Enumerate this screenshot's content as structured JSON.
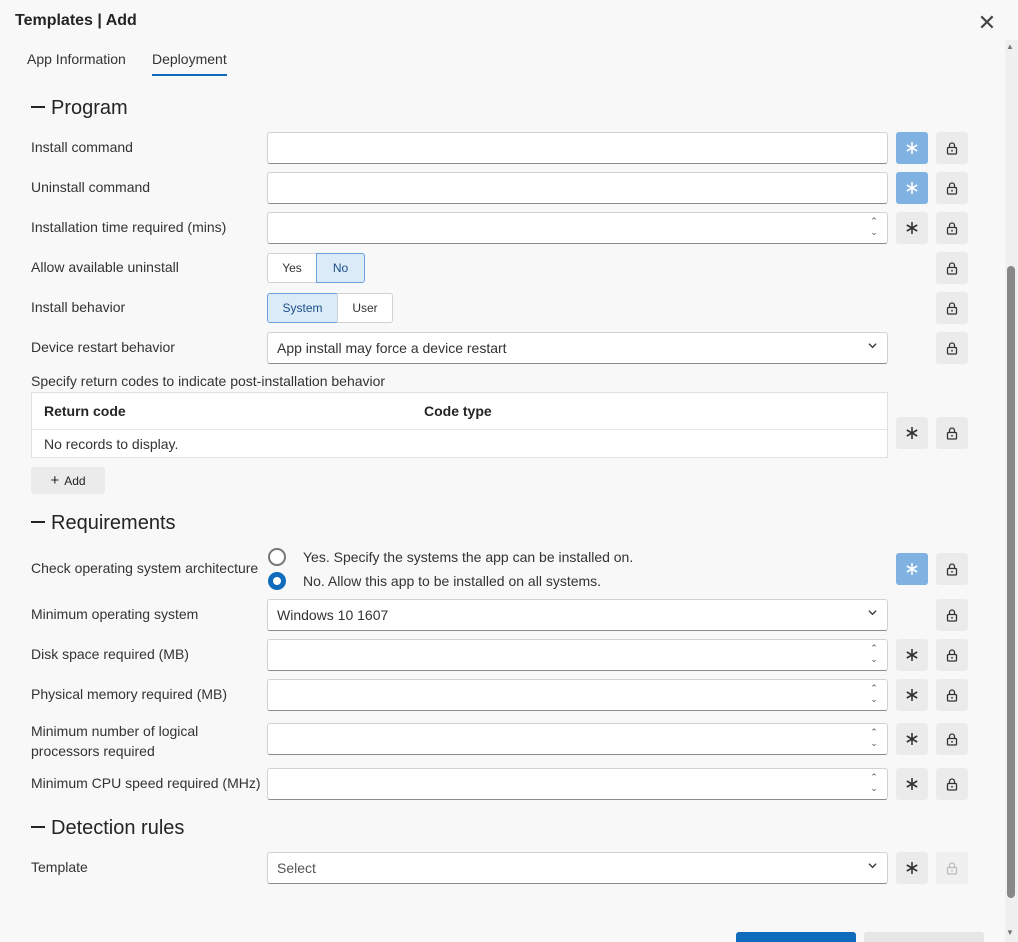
{
  "header": {
    "title": "Templates | Add"
  },
  "tabs": [
    {
      "label": "App Information"
    },
    {
      "label": "Deployment"
    }
  ],
  "sections": {
    "program": "Program",
    "requirements": "Requirements",
    "detection": "Detection rules"
  },
  "program": {
    "install_command": {
      "label": "Install command",
      "value": ""
    },
    "uninstall_command": {
      "label": "Uninstall command",
      "value": ""
    },
    "install_time": {
      "label": "Installation time required (mins)",
      "value": ""
    },
    "allow_uninstall": {
      "label": "Allow available uninstall",
      "options": [
        "Yes",
        "No"
      ],
      "selected": "No"
    },
    "install_behavior": {
      "label": "Install behavior",
      "options": [
        "System",
        "User"
      ],
      "selected": "System"
    },
    "restart_behavior": {
      "label": "Device restart behavior",
      "value": "App install may force a device restart"
    },
    "return_codes": {
      "label": "Specify return codes to indicate post-installation behavior",
      "columns": [
        "Return code",
        "Code type"
      ],
      "empty_text": "No records to display.",
      "add_label": "Add"
    }
  },
  "requirements": {
    "os_arch": {
      "label": "Check operating system architecture",
      "option_yes": "Yes. Specify the systems the app can be installed on.",
      "option_no": "No. Allow this app to be installed on all systems.",
      "selected": "No"
    },
    "min_os": {
      "label": "Minimum operating system",
      "value": "Windows 10 1607"
    },
    "disk_space": {
      "label": "Disk space required (MB)",
      "value": ""
    },
    "memory": {
      "label": "Physical memory required (MB)",
      "value": ""
    },
    "processors": {
      "label_line1": "Minimum number of logical",
      "label_line2": "processors required",
      "value": ""
    },
    "cpu_speed": {
      "label": "Minimum CPU speed required (MHz)",
      "value": ""
    }
  },
  "detection": {
    "template": {
      "label": "Template",
      "placeholder": "Select"
    }
  },
  "icons": {
    "close": "close-icon",
    "asterisk": "asterisk-icon",
    "lock": "lock-icon",
    "chevron": "chevron-down-icon",
    "add": "plus-icon"
  },
  "colors": {
    "accent": "#0f6cbd",
    "asterisk_active": "#7fb2e0",
    "toggle_selected": "#dcebf8"
  }
}
